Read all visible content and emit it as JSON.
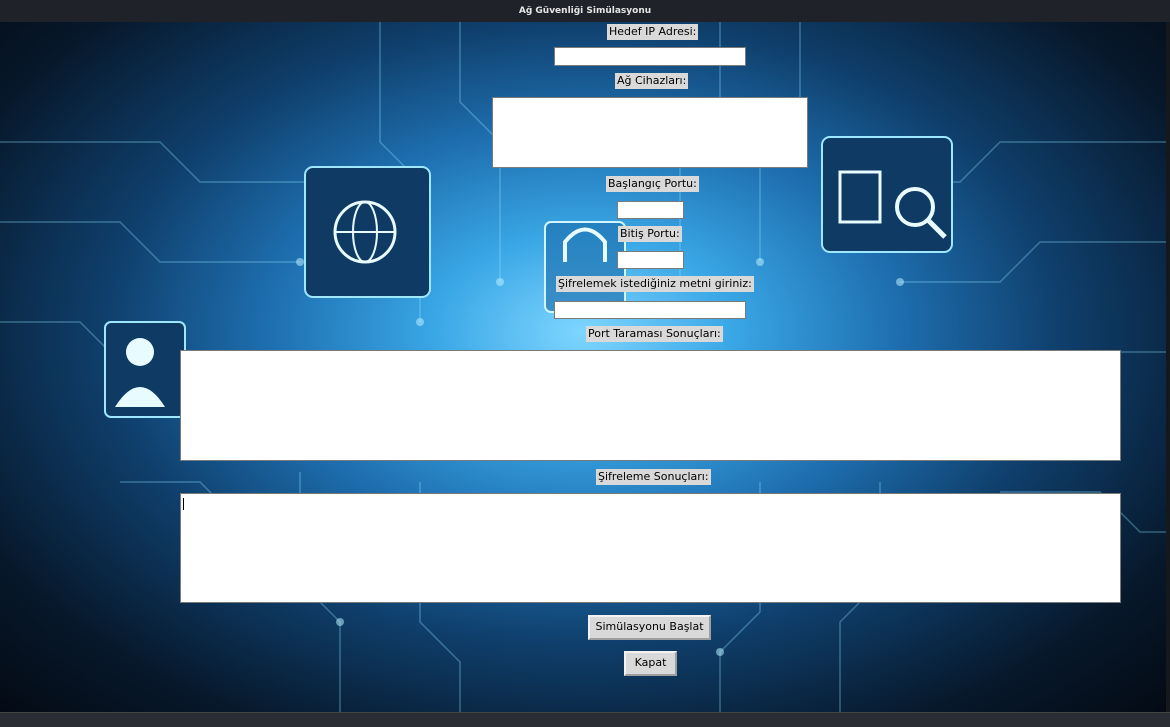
{
  "window": {
    "title": "Ağ Güvenliği Simülasyonu"
  },
  "form": {
    "target_ip_label": "Hedef IP Adresi:",
    "target_ip_value": "",
    "devices_label": "Ağ Cihazları:",
    "devices_value": "",
    "start_port_label": "Başlangıç Portu:",
    "start_port_value": "",
    "end_port_label": "Bitiş Portu:",
    "end_port_value": "",
    "encrypt_text_label": "Şifrelemek istediğiniz metni giriniz:",
    "encrypt_text_value": "",
    "port_scan_results_label": "Port Taraması Sonuçları:",
    "port_scan_results_value": "",
    "encryption_results_label": "Şifreleme Sonuçları:",
    "encryption_results_value": ""
  },
  "buttons": {
    "start_simulation": "Simülasyonu Başlat",
    "close": "Kapat"
  },
  "background": {
    "theme": "cyber-network circuit background",
    "accent_color": "#3aa7e6",
    "icons": [
      "globe-icon",
      "document-search-icon",
      "user-icon",
      "padlock-icon"
    ]
  }
}
